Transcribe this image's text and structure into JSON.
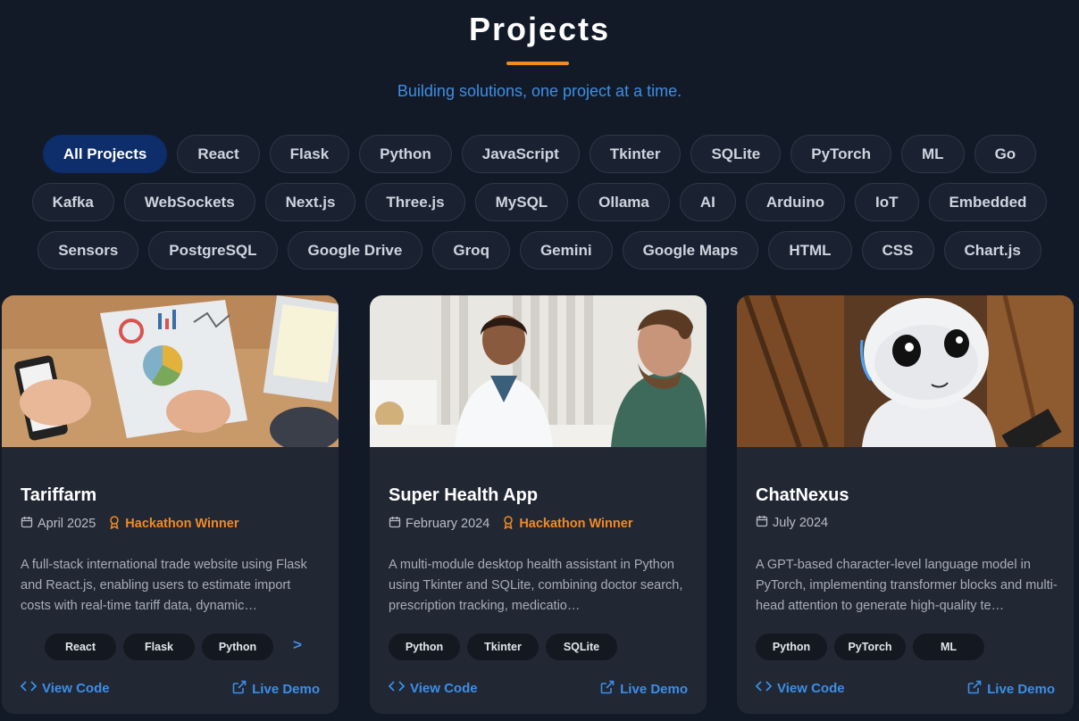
{
  "header": {
    "title": "Projects",
    "subtitle": "Building solutions, one project at a time."
  },
  "filters": {
    "row1": [
      "All Projects",
      "React",
      "Flask",
      "Python",
      "JavaScript",
      "Tkinter",
      "SQLite",
      "PyTorch",
      "ML",
      "Go"
    ],
    "row2": [
      "Kafka",
      "WebSockets",
      "Next.js",
      "Three.js",
      "MySQL",
      "Ollama",
      "AI",
      "Arduino",
      "IoT",
      "Embedded"
    ],
    "row3": [
      "Sensors",
      "PostgreSQL",
      "Google Drive",
      "Groq",
      "Gemini",
      "Google Maps",
      "HTML",
      "CSS",
      "Chart.js"
    ],
    "active": "All Projects"
  },
  "projects": [
    {
      "title": "Tariffarm",
      "date": "April 2025",
      "award": "Hackathon Winner",
      "description": "A full-stack international trade website using Flask and React.js, enabling users to estimate import costs with real-time tariff data, dynamic…",
      "tags": [
        "React",
        "Flask",
        "Python"
      ],
      "more": ">",
      "view_code": "View Code",
      "live_demo": "Live Demo",
      "image": "data-charts-on-desk-photo"
    },
    {
      "title": "Super Health App",
      "date": "February 2024",
      "award": "Hackathon Winner",
      "description": "A multi-module desktop health assistant in Python using Tkinter and SQLite, combining doctor search, prescription tracking, medicatio…",
      "tags": [
        "Python",
        "Tkinter",
        "SQLite"
      ],
      "view_code": "View Code",
      "live_demo": "Live Demo",
      "image": "doctor-consultation-photo"
    },
    {
      "title": "ChatNexus",
      "date": "July 2024",
      "description": "A GPT-based character-level language model in PyTorch, implementing transformer blocks and multi-head attention to generate high-quality te…",
      "tags": [
        "Python",
        "PyTorch",
        "ML"
      ],
      "view_code": "View Code",
      "live_demo": "Live Demo",
      "image": "white-robot-photo"
    }
  ],
  "colors": {
    "background": "#131a27",
    "card": "#222734",
    "accent": "#3b8fe8",
    "award": "#f28a23",
    "active_chip": "#0d2d6b"
  }
}
